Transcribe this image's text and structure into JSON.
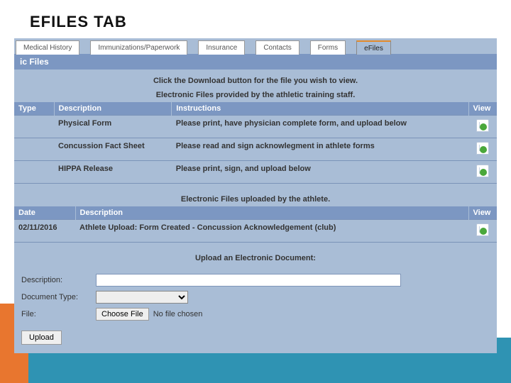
{
  "slide": {
    "title": "EFILES TAB"
  },
  "tabs": {
    "items": [
      {
        "label": "Medical History"
      },
      {
        "label": "Immunizations/Paperwork"
      },
      {
        "label": "Insurance"
      },
      {
        "label": "Contacts"
      },
      {
        "label": "Forms"
      },
      {
        "label": "eFiles"
      }
    ],
    "active_index": 5
  },
  "panel": {
    "title": "ic Files"
  },
  "hints": {
    "download": "Click the Download button for the file you wish to view.",
    "provided": "Electronic Files provided by the athletic training staff.",
    "uploaded": "Electronic Files uploaded by the athlete.",
    "upload_doc": "Upload an Electronic Document:"
  },
  "provided_table": {
    "headers": {
      "type": "Type",
      "description": "Description",
      "instructions": "Instructions",
      "view": "View"
    },
    "rows": [
      {
        "type": "",
        "description": "Physical Form",
        "instructions": "Please print, have physician complete form, and upload below"
      },
      {
        "type": "",
        "description": "Concussion Fact Sheet",
        "instructions": "Please read and sign acknowlegment in athlete forms"
      },
      {
        "type": "",
        "description": "HIPPA Release",
        "instructions": "Please print, sign, and upload below"
      }
    ]
  },
  "uploaded_table": {
    "headers": {
      "date": "Date",
      "description": "Description",
      "view": "View"
    },
    "rows": [
      {
        "date": "02/11/2016",
        "description": "Athlete Upload: Form Created - Concussion Acknowledgement (club)"
      }
    ]
  },
  "upload_form": {
    "description_label": "Description:",
    "description_value": "",
    "doctype_label": "Document Type:",
    "doctype_value": "",
    "file_label": "File:",
    "choose_file": "Choose File",
    "no_file": "No file chosen",
    "upload_btn": "Upload"
  }
}
